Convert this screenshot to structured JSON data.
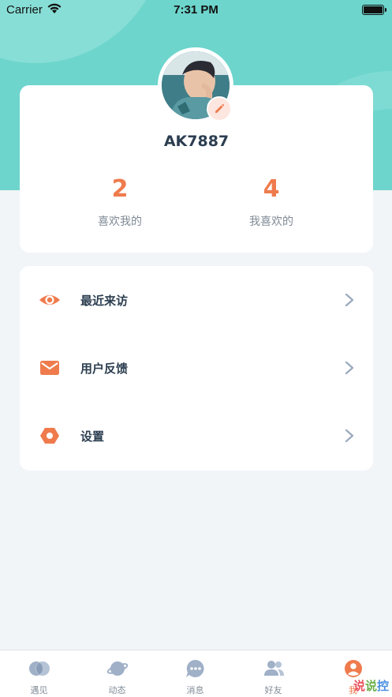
{
  "status_bar": {
    "carrier": "Carrier",
    "time": "7:31 PM"
  },
  "profile": {
    "username": "AK7887",
    "stats": [
      {
        "value": "2",
        "label": "喜欢我的"
      },
      {
        "value": "4",
        "label": "我喜欢的"
      }
    ]
  },
  "menu": {
    "items": [
      {
        "label": "最近来访",
        "icon": "eye-icon"
      },
      {
        "label": "用户反馈",
        "icon": "mail-icon"
      },
      {
        "label": "设置",
        "icon": "settings-hexagon-icon"
      }
    ]
  },
  "tabbar": {
    "tabs": [
      {
        "label": "遇见",
        "icon": "encounter-circles-icon"
      },
      {
        "label": "动态",
        "icon": "planet-icon"
      },
      {
        "label": "消息",
        "icon": "chat-bubble-icon"
      },
      {
        "label": "好友",
        "icon": "friends-icon"
      },
      {
        "label": "我",
        "icon": "profile-icon"
      }
    ],
    "active_index": 4
  },
  "watermark": {
    "chars": [
      "说",
      "说",
      "控"
    ]
  },
  "colors": {
    "accent": "#ef7b4d",
    "header": "#6dd5cc",
    "tab_inactive": "#9fb0c7",
    "text_primary": "#2c3e50",
    "text_secondary": "#808b96"
  }
}
